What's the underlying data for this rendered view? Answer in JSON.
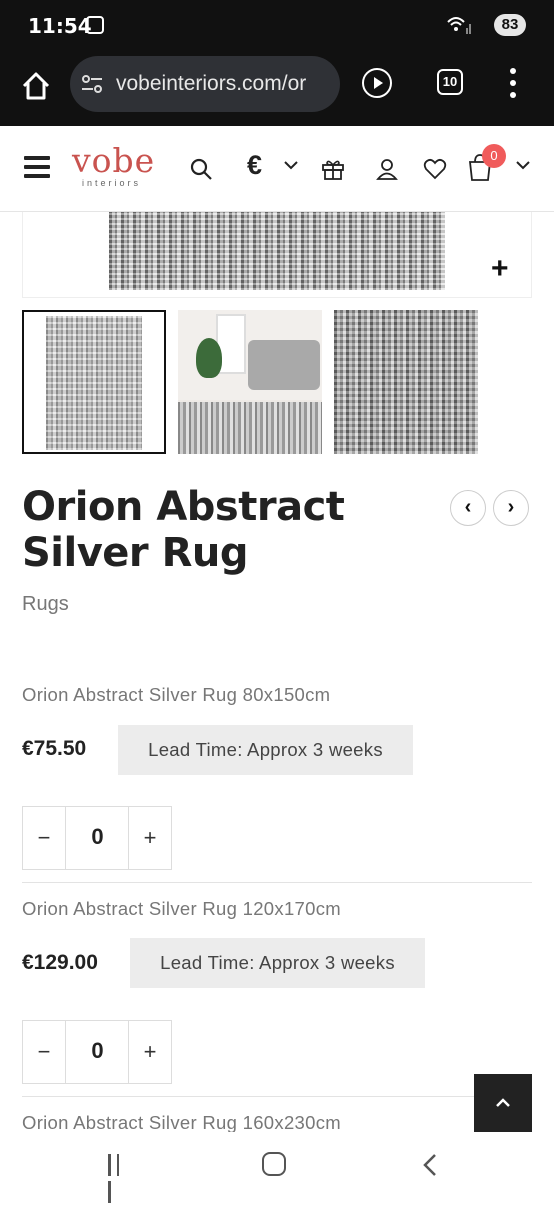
{
  "status_bar": {
    "time": "11:54",
    "battery": "83"
  },
  "browser": {
    "url": "vobeinteriors.com/or",
    "tab_count": "10"
  },
  "header": {
    "logo_text": "vobe",
    "logo_subtext": "interiors",
    "currency_symbol": "€",
    "cart_count": "0"
  },
  "product": {
    "title": "Orion Abstract Silver Rug",
    "category": "Rugs",
    "variants": [
      {
        "name": "Orion Abstract Silver Rug 80x150cm",
        "price": "€75.50",
        "lead_time": "Lead Time: Approx 3 weeks",
        "quantity": "0"
      },
      {
        "name": "Orion Abstract Silver Rug 120x170cm",
        "price": "€129.00",
        "lead_time": "Lead Time: Approx 3 weeks",
        "quantity": "0"
      },
      {
        "name": "Orion Abstract Silver Rug 160x230cm"
      }
    ]
  },
  "icons": {
    "qty_minus": "−",
    "qty_plus": "+",
    "zoom": "+",
    "prev": "‹",
    "next": "›"
  },
  "colors": {
    "brand": "#c9534f",
    "badge": "#f05b5b",
    "dark": "#111111"
  }
}
